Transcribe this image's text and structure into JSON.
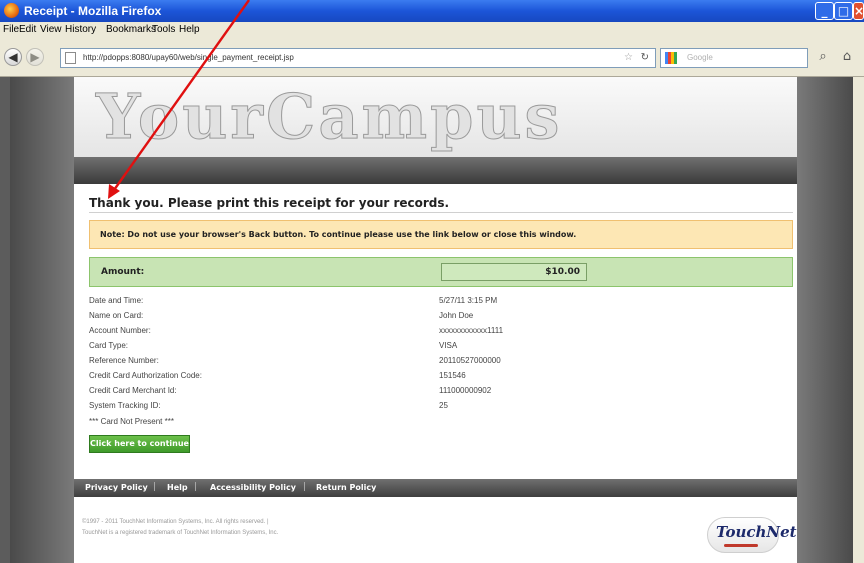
{
  "window": {
    "title": "Receipt - Mozilla Firefox"
  },
  "menu": [
    "File",
    "Edit",
    "View",
    "History",
    "Bookmarks",
    "Tools",
    "Help"
  ],
  "browser": {
    "url": "http://pdopps:8080/upay60/web/single_payment_receipt.jsp",
    "search_placeholder": "Google"
  },
  "site": {
    "logo_text": "YourCampus"
  },
  "receipt": {
    "heading": "Thank you. Please print this receipt for your records.",
    "note": "Note: Do not use your browser's Back button. To continue please use the link below or close this window.",
    "amount_label": "Amount:",
    "amount_value": "$10.00",
    "rows": [
      {
        "label": "Date and Time:",
        "value": "5/27/11 3:15 PM"
      },
      {
        "label": "Name on Card:",
        "value": "John Doe"
      },
      {
        "label": "Account Number:",
        "value": "xxxxxxxxxxxx1111"
      },
      {
        "label": "Card Type:",
        "value": "VISA"
      },
      {
        "label": "Reference Number:",
        "value": "20110527000000"
      },
      {
        "label": "Credit Card Authorization Code:",
        "value": "151546"
      },
      {
        "label": "Credit Card Merchant Id:",
        "value": "111000000902"
      },
      {
        "label": "System Tracking ID:",
        "value": "25"
      }
    ],
    "card_not_present": "*** Card Not Present ***",
    "continue_label": "Click here to continue"
  },
  "footer": {
    "links": [
      "Privacy Policy",
      "Help",
      "Accessibility Policy",
      "Return Policy"
    ],
    "copyright_1": "©1997 - 2011 TouchNet Information Systems, Inc. All rights reserved. |",
    "copyright_2": "TouchNet is a registered trademark of TouchNet Information Systems, Inc.",
    "brand": "TouchNet"
  },
  "colors": {
    "note_bg": "#fde7b4",
    "amount_bg": "#c8e4b4",
    "button_green": "#4ea935",
    "annotation_arrow": "#e01010"
  },
  "icons": [
    "firefox-icon",
    "back-arrow-icon",
    "forward-arrow-icon",
    "page-icon",
    "bookmark-star-icon",
    "reload-icon",
    "google-icon",
    "magnifier-icon",
    "home-icon"
  ]
}
